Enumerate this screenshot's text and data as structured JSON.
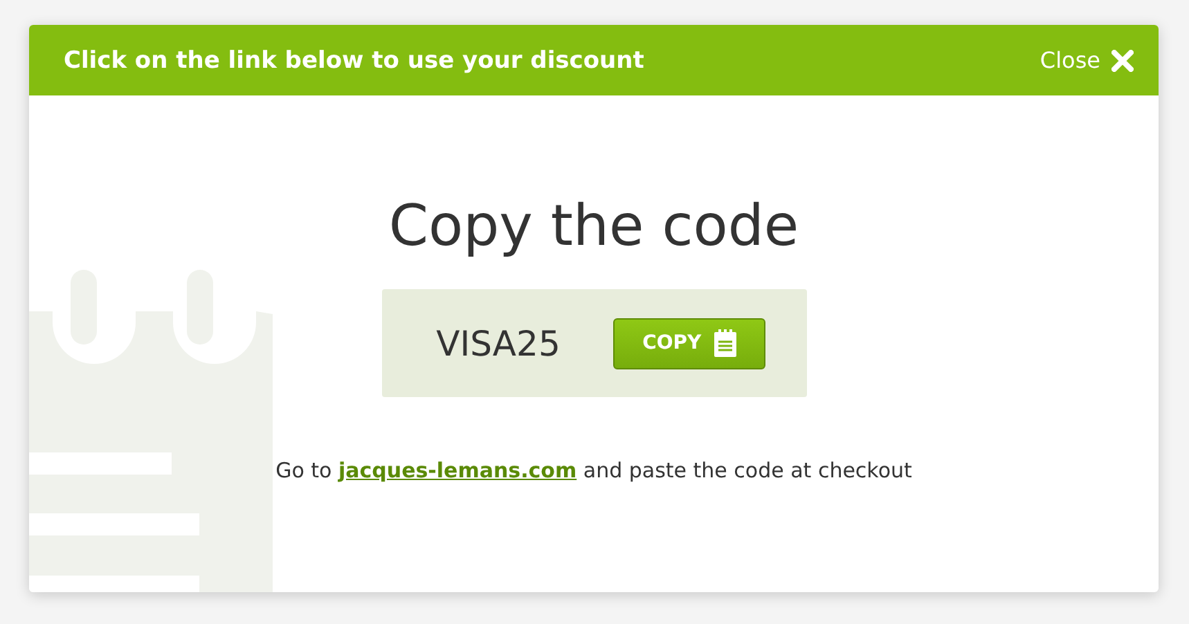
{
  "header": {
    "title": "Click on the link below to use your discount",
    "close_label": "Close"
  },
  "heading": "Copy the code",
  "coupon": {
    "code": "VISA25",
    "button_label": "COPY"
  },
  "instruction": {
    "before": "Go to ",
    "link": "jacques-lemans.com",
    "after": " and paste the code at checkout"
  }
}
